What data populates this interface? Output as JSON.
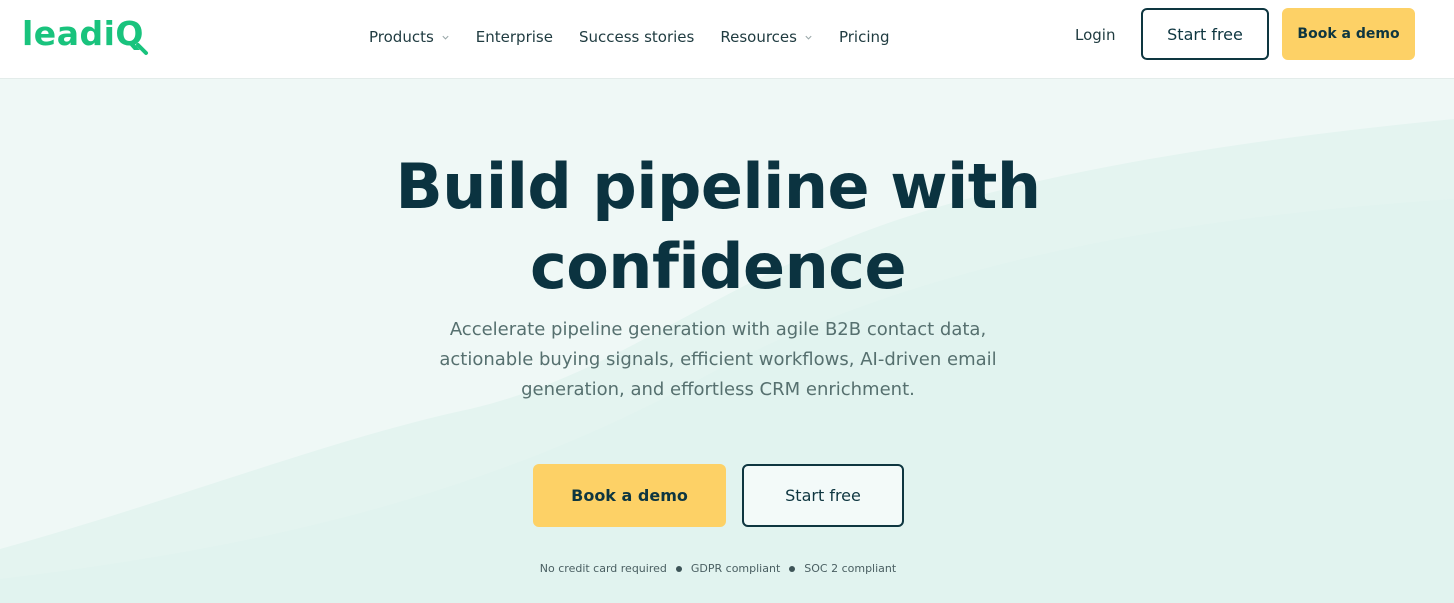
{
  "brand": {
    "logo_text": "leadiQ",
    "color": "#19c37d"
  },
  "nav": {
    "items": [
      {
        "label": "Products",
        "has_dropdown": true
      },
      {
        "label": "Enterprise",
        "has_dropdown": false
      },
      {
        "label": "Success stories",
        "has_dropdown": false
      },
      {
        "label": "Resources",
        "has_dropdown": true
      },
      {
        "label": "Pricing",
        "has_dropdown": false
      }
    ],
    "login_label": "Login",
    "start_free_label": "Start free",
    "book_demo_label": "Book a demo"
  },
  "hero": {
    "headline_line1": "Build pipeline with",
    "headline_line2": "confidence",
    "subhead_line1": "Accelerate pipeline generation with agile B2B contact data,",
    "subhead_line2": "actionable buying signals, efficient workflows, AI-driven email",
    "subhead_line3": "generation, and effortless CRM enrichment.",
    "book_demo_label": "Book a demo",
    "start_free_label": "Start free",
    "trust_items": [
      "No credit card required",
      "GDPR compliant",
      "SOC 2 compliant"
    ]
  },
  "colors": {
    "primary_dark": "#0e3640",
    "accent_yellow": "#fdd166",
    "hero_bg": "#eff8f6",
    "brand_green": "#19c37d"
  },
  "icons": {
    "dropdown": "chevron-down-icon",
    "separator": "dot-separator"
  }
}
